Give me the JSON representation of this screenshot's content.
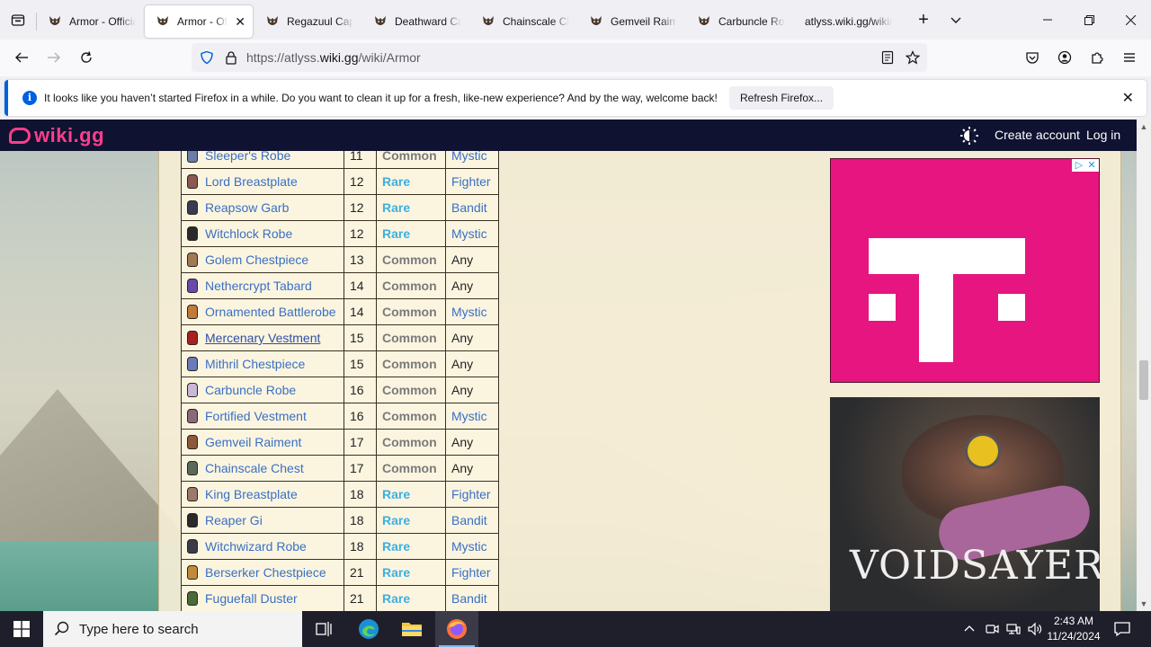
{
  "browser": {
    "tabs": [
      {
        "title": "Armor - Official Atlyss Wiki",
        "active": false
      },
      {
        "title": "Armor - Official Atlyss Wiki",
        "active": true
      },
      {
        "title": "Regazuul Cape",
        "active": false
      },
      {
        "title": "Deathward Cape",
        "active": false
      },
      {
        "title": "Chainscale Chest",
        "active": false
      },
      {
        "title": "Gemveil Raiment",
        "active": false
      },
      {
        "title": "Carbuncle Robe",
        "active": false
      },
      {
        "title": "atlyss.wiki.gg/wiki/",
        "active": false
      }
    ],
    "url_prefix": "https://atlyss.",
    "url_domain": "wiki.gg",
    "url_path": "/wiki/Armor"
  },
  "notification": {
    "message": "It looks like you haven’t started Firefox in a while. Do you want to clean it up for a fresh, like-new experience? And by the way, welcome back!",
    "button": "Refresh Firefox..."
  },
  "wiki": {
    "logo": "wiki.gg",
    "create_account": "Create account",
    "log_in": "Log in"
  },
  "armor_table": [
    {
      "name": "Sleeper's Robe",
      "level": "11",
      "rarity": "Common",
      "class": "Mystic",
      "icon_color": "#6a7da8"
    },
    {
      "name": "Lord Breastplate",
      "level": "12",
      "rarity": "Rare",
      "class": "Fighter",
      "icon_color": "#8a5a52"
    },
    {
      "name": "Reapsow Garb",
      "level": "12",
      "rarity": "Rare",
      "class": "Bandit",
      "icon_color": "#3a3a52"
    },
    {
      "name": "Witchlock Robe",
      "level": "12",
      "rarity": "Rare",
      "class": "Mystic",
      "icon_color": "#2a2a2a"
    },
    {
      "name": "Golem Chestpiece",
      "level": "13",
      "rarity": "Common",
      "class": "Any",
      "icon_color": "#a07a52"
    },
    {
      "name": "Nethercrypt Tabard",
      "level": "14",
      "rarity": "Common",
      "class": "Any",
      "icon_color": "#6a4aa8"
    },
    {
      "name": "Ornamented Battlerobe",
      "level": "14",
      "rarity": "Common",
      "class": "Mystic",
      "icon_color": "#c07a3a"
    },
    {
      "name": "Mercenary Vestment",
      "level": "15",
      "rarity": "Common",
      "class": "Any",
      "icon_color": "#a82020"
    },
    {
      "name": "Mithril Chestpiece",
      "level": "15",
      "rarity": "Common",
      "class": "Any",
      "icon_color": "#6a7ab8"
    },
    {
      "name": "Carbuncle Robe",
      "level": "16",
      "rarity": "Common",
      "class": "Any",
      "icon_color": "#c8b8d8"
    },
    {
      "name": "Fortified Vestment",
      "level": "16",
      "rarity": "Common",
      "class": "Mystic",
      "icon_color": "#8a6a7a"
    },
    {
      "name": "Gemveil Raiment",
      "level": "17",
      "rarity": "Common",
      "class": "Any",
      "icon_color": "#8a5a3a"
    },
    {
      "name": "Chainscale Chest",
      "level": "17",
      "rarity": "Common",
      "class": "Any",
      "icon_color": "#5a6a5a"
    },
    {
      "name": "King Breastplate",
      "level": "18",
      "rarity": "Rare",
      "class": "Fighter",
      "icon_color": "#9a7a6a"
    },
    {
      "name": "Reaper Gi",
      "level": "18",
      "rarity": "Rare",
      "class": "Bandit",
      "icon_color": "#2a2a2a"
    },
    {
      "name": "Witchwizard Robe",
      "level": "18",
      "rarity": "Rare",
      "class": "Mystic",
      "icon_color": "#3a3a4a"
    },
    {
      "name": "Berserker Chestpiece",
      "level": "21",
      "rarity": "Rare",
      "class": "Fighter",
      "icon_color": "#c08a3a"
    },
    {
      "name": "Fuguefall Duster",
      "level": "21",
      "rarity": "Rare",
      "class": "Bandit",
      "icon_color": "#4a6a3a"
    }
  ],
  "ads": {
    "ad2_title": "VOIDSAYER"
  },
  "taskbar": {
    "search_placeholder": "Type here to search",
    "time": "2:43 AM",
    "date": "11/24/2024"
  },
  "colors": {
    "wiki_bar": "#0f1230",
    "wiki_logo": "#ff3d8b",
    "rare": "#3dafe0",
    "common": "#7a7a7a",
    "link": "#3a6fc4",
    "firefox_accent": "#0060df"
  }
}
